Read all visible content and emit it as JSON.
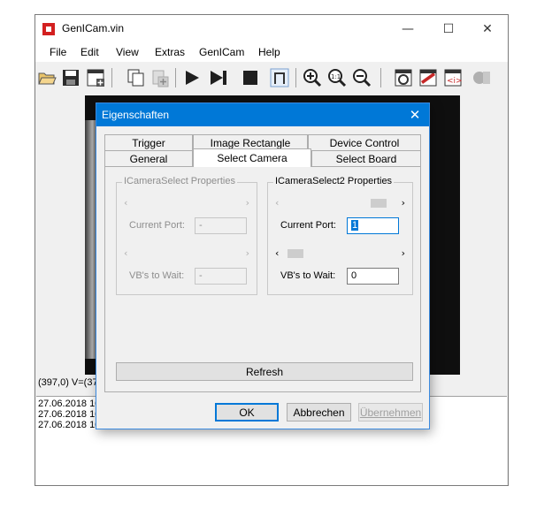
{
  "app": {
    "title": "GenICam.vin",
    "minimize": "—",
    "maximize": "☐",
    "close": "✕"
  },
  "menu": [
    "File",
    "Edit",
    "View",
    "Extras",
    "GenICam",
    "Help"
  ],
  "toolbar_icons": [
    "open-folder-icon",
    "save-icon",
    "new-window-icon",
    "copy-icon",
    "paste-icon",
    "play-icon",
    "step-forward-icon",
    "stop-icon",
    "capture-frame-icon",
    "zoom-in-icon",
    "zoom-reset-icon",
    "zoom-out-icon",
    "camera-icon",
    "settings-icon",
    "xml-icon",
    "plugins-icon"
  ],
  "status": "(397,0) V=(37",
  "log": [
    "27.06.2018 10",
    "27.06.2018 10",
    "27.06.2018 10"
  ],
  "dialog": {
    "title": "Eigenschaften",
    "tabs_row1": [
      "Trigger",
      "Image Rectangle",
      "Device Control"
    ],
    "tabs_row2": [
      "General",
      "Select Camera",
      "Select Board"
    ],
    "left_group": {
      "title": "ICameraSelect Properties",
      "current_port_label": "Current Port:",
      "current_port_value": "-",
      "vbs_label": "VB's to Wait:",
      "vbs_value": "-"
    },
    "right_group": {
      "title": "ICameraSelect2 Properties",
      "current_port_label": "Current Port:",
      "current_port_value": "1",
      "vbs_label": "VB's to Wait:",
      "vbs_value": "0"
    },
    "arrow_left": "‹",
    "arrow_right": "›",
    "refresh": "Refresh",
    "ok": "OK",
    "cancel": "Abbrechen",
    "apply": "Übernehmen"
  },
  "colors": {
    "accent": "#0078d7",
    "app_icon": "#d32020"
  }
}
